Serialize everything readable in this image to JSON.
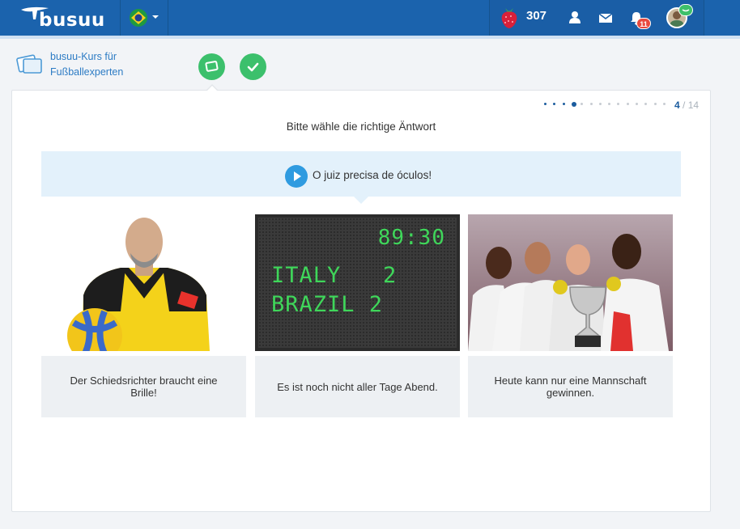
{
  "header": {
    "logo_text": "busuu",
    "language_flag": "brazil-flag",
    "points": "307",
    "notifications_count": "11",
    "icons": [
      "strawberry-icon",
      "profile-icon",
      "mail-icon",
      "bell-icon",
      "avatar-icon"
    ],
    "brand_color": "#1b63ad"
  },
  "course": {
    "title": "busuu-Kurs für Fußballexperten",
    "steps": [
      "practice-step-icon",
      "checkmark-step-icon"
    ]
  },
  "exercise": {
    "progress": {
      "current": "4",
      "total": "/ 14",
      "dots_total": 14,
      "dots_done": 3
    },
    "instruction": "Bitte wähle die richtige Äntwort",
    "prompt": "O juiz precisa de óculos!",
    "options": [
      {
        "label": "Der Schiedsrichter braucht eine Brille!",
        "image": "referee-photo"
      },
      {
        "label": "Es ist noch nicht aller Tage Abend.",
        "image": "scoreboard-photo",
        "scoreboard": {
          "time": "89:30",
          "line1": "ITALY   2",
          "line2": "BRAZIL 2"
        }
      },
      {
        "label": "Heute kann nur eine Mannschaft gewinnen.",
        "image": "team-trophy-photo"
      }
    ]
  }
}
